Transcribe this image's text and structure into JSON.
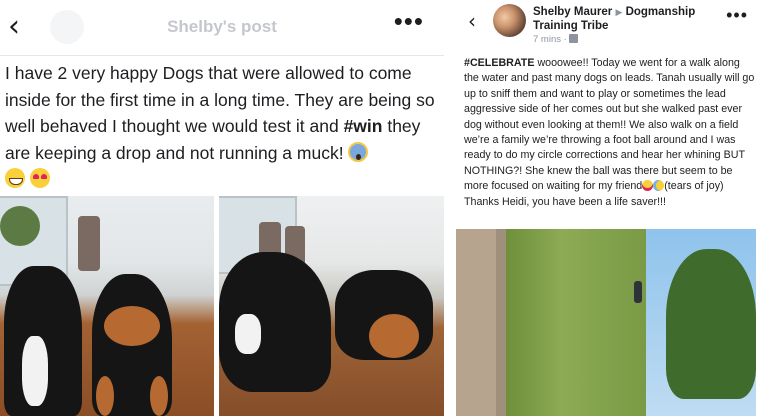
{
  "left_post": {
    "header_title": "Shelby's post",
    "text_main": "I have 2 very happy Dogs that were allowed to come inside for the first time in a long time. They are being so well behaved I thought we would test it and ",
    "hashtag": "#win",
    "text_after": " they are keeping a drop and not running a muck! ",
    "emojis": [
      "scream-emoji",
      "grin-emoji",
      "heart-eyes-emoji"
    ],
    "photos": [
      "two-dogs-photo-left",
      "two-dogs-photo-right"
    ]
  },
  "right_post": {
    "author": "Shelby Maurer",
    "group": "Dogmanship Training Tribe",
    "timestamp": "7 mins",
    "separator": "·",
    "hashtag": "#CELEBRATE",
    "text_main": " wooowee!! Today we went for a walk along the water and past many dogs on leads. Tanah usually will go up to sniff them and want to play or sometimes the lead aggressive side of her comes out but she walked past ever dog without even looking at them!! We also walk on a field we’re a family we’re throwing a foot ball around and I was ready to do my circle corrections and hear her whining BUT NOTHING?! She knew the ball was there but seem to be more focused on waiting for my friend",
    "text_tail_1": "(tears of joy) Thanks Heidi, you have been a life saver!!!",
    "video": "park-video-thumbnail"
  },
  "icons": {
    "back": "‹",
    "more": "•••",
    "arrow": "▶"
  }
}
